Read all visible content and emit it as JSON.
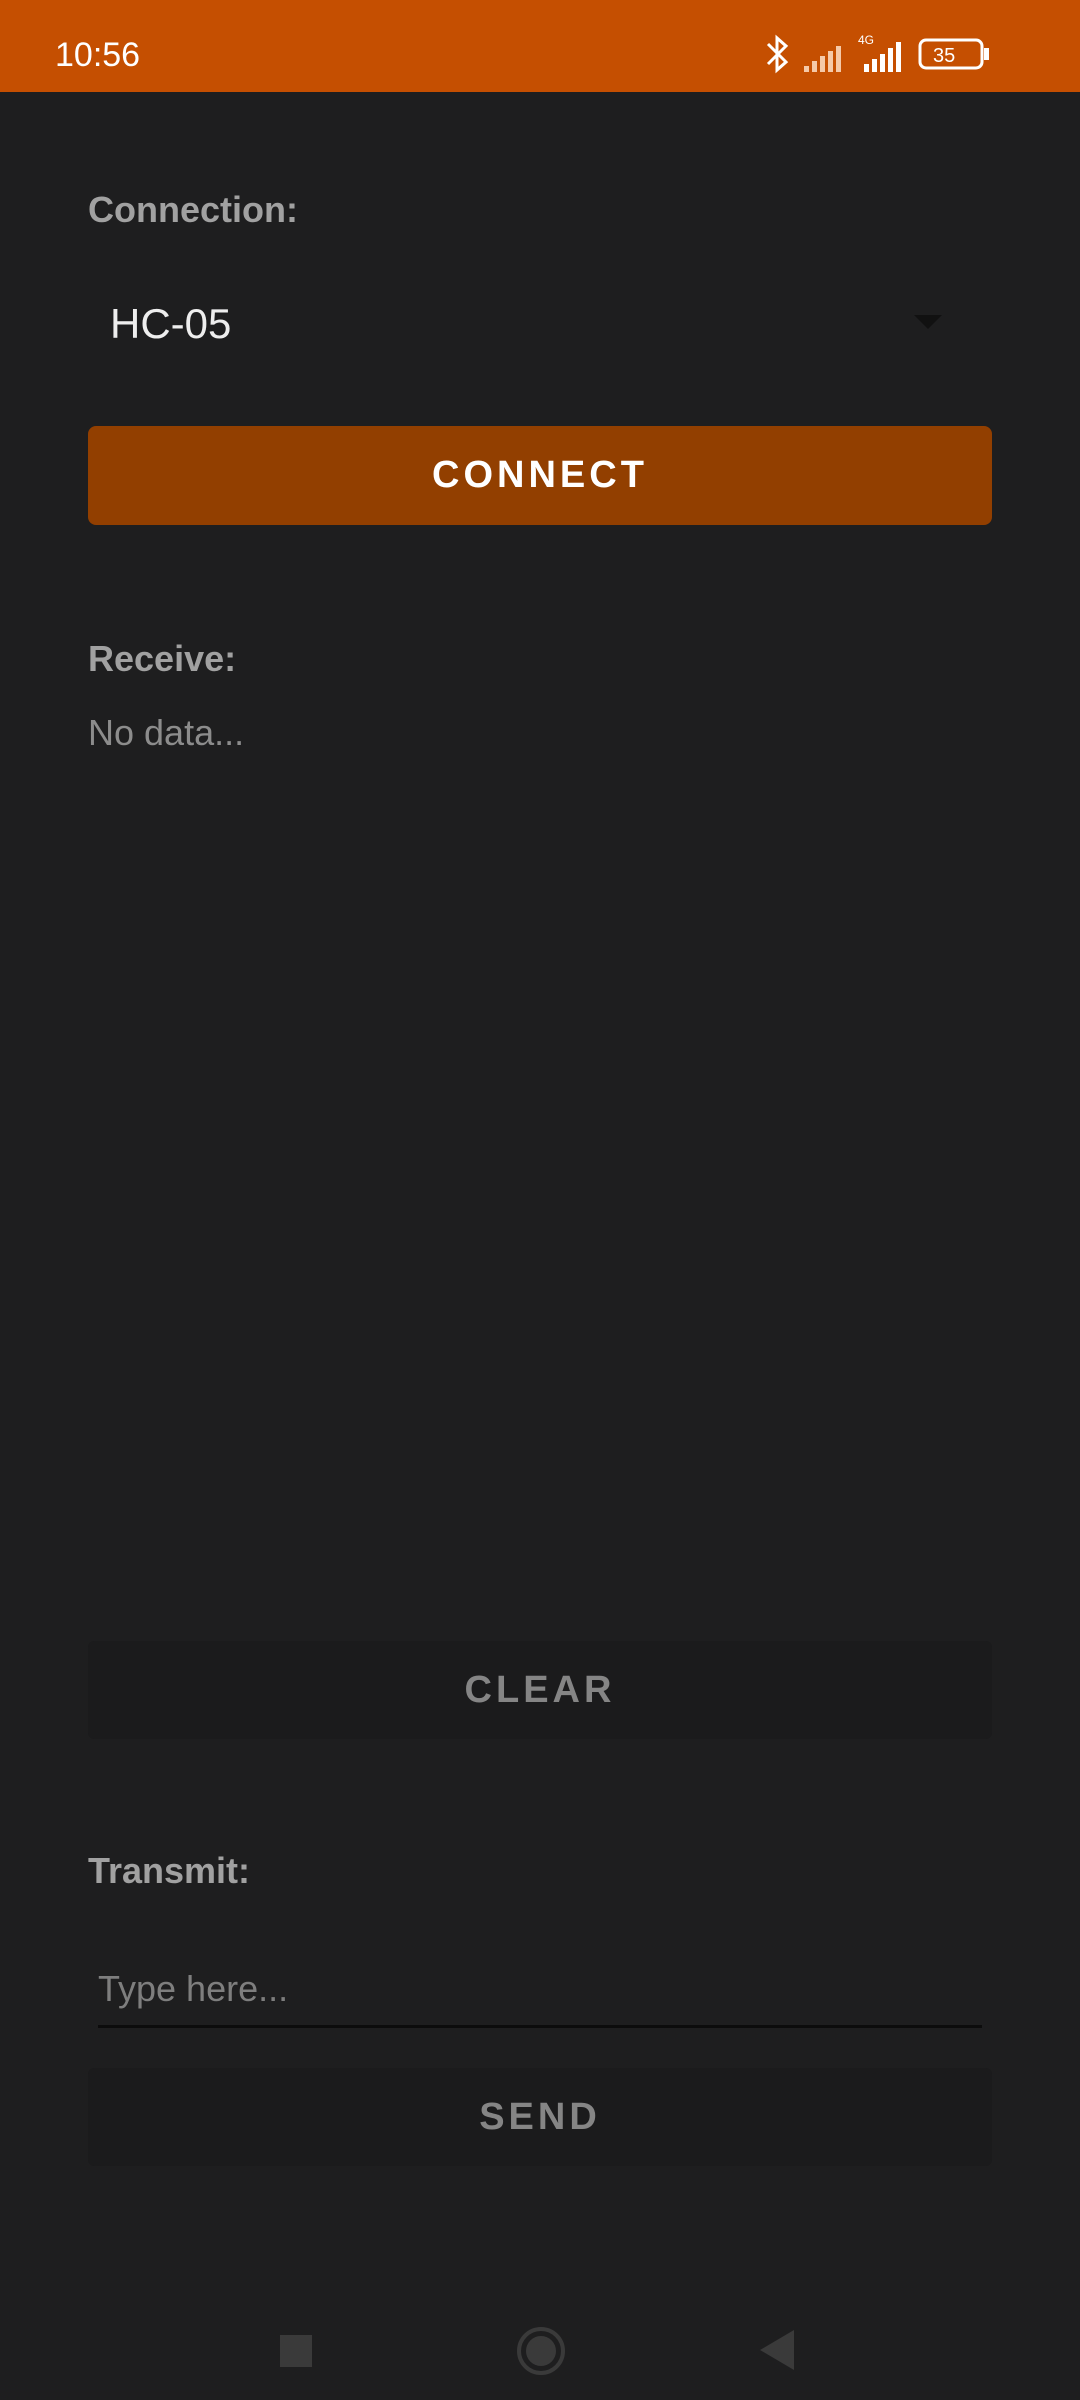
{
  "status_bar": {
    "time": "10:56",
    "battery": "35",
    "network": "4G"
  },
  "connection": {
    "label": "Connection:",
    "selected_device": "HC-05"
  },
  "connect_button": {
    "label": "CONNECT"
  },
  "receive": {
    "label": "Receive:",
    "text": "No data..."
  },
  "clear_button": {
    "label": "CLEAR"
  },
  "transmit": {
    "label": "Transmit:",
    "placeholder": "Type here...",
    "value": ""
  },
  "send_button": {
    "label": "SEND"
  },
  "colors": {
    "status_bar": "#c54f01",
    "accent_button": "#923f00",
    "background": "#1e1e1f"
  }
}
